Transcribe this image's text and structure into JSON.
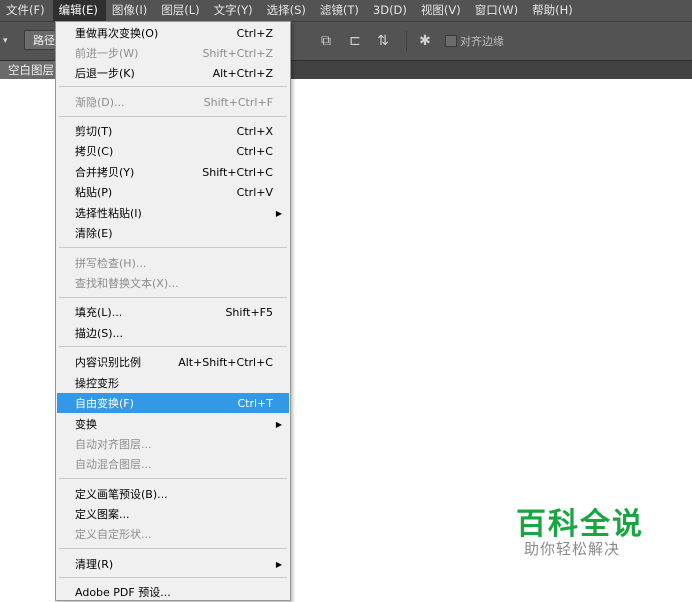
{
  "menubar": {
    "items": [
      {
        "label": "文件(F)"
      },
      {
        "label": "编辑(E)"
      },
      {
        "label": "图像(I)"
      },
      {
        "label": "图层(L)"
      },
      {
        "label": "文字(Y)"
      },
      {
        "label": "选择(S)"
      },
      {
        "label": "滤镜(T)"
      },
      {
        "label": "3D(D)"
      },
      {
        "label": "视图(V)"
      },
      {
        "label": "窗口(W)"
      },
      {
        "label": "帮助(H)"
      }
    ],
    "active_index": 1
  },
  "options_bar": {
    "path_button_label": "路径",
    "align_edges_label": "对齐边缘"
  },
  "document_tab": {
    "title": "空白图层"
  },
  "edit_menu": {
    "items": [
      {
        "label": "重做再次变换(O)",
        "shortcut": "Ctrl+Z",
        "disabled": false
      },
      {
        "label": "前进一步(W)",
        "shortcut": "Shift+Ctrl+Z",
        "disabled": true
      },
      {
        "label": "后退一步(K)",
        "shortcut": "Alt+Ctrl+Z",
        "disabled": false
      },
      {
        "label": "渐隐(D)...",
        "shortcut": "Shift+Ctrl+F",
        "disabled": true
      },
      {
        "label": "剪切(T)",
        "shortcut": "Ctrl+X",
        "disabled": false
      },
      {
        "label": "拷贝(C)",
        "shortcut": "Ctrl+C",
        "disabled": false
      },
      {
        "label": "合并拷贝(Y)",
        "shortcut": "Shift+Ctrl+C",
        "disabled": false
      },
      {
        "label": "粘贴(P)",
        "shortcut": "Ctrl+V",
        "disabled": false
      },
      {
        "label": "选择性粘贴(I)",
        "shortcut": "",
        "disabled": false,
        "submenu": true
      },
      {
        "label": "清除(E)",
        "shortcut": "",
        "disabled": false
      },
      {
        "label": "拼写检查(H)...",
        "shortcut": "",
        "disabled": true
      },
      {
        "label": "查找和替换文本(X)...",
        "shortcut": "",
        "disabled": true
      },
      {
        "label": "填充(L)...",
        "shortcut": "Shift+F5",
        "disabled": false
      },
      {
        "label": "描边(S)...",
        "shortcut": "",
        "disabled": false
      },
      {
        "label": "内容识别比例",
        "shortcut": "Alt+Shift+Ctrl+C",
        "disabled": false
      },
      {
        "label": "操控变形",
        "shortcut": "",
        "disabled": false
      },
      {
        "label": "自由变换(F)",
        "shortcut": "Ctrl+T",
        "disabled": false,
        "selected": true
      },
      {
        "label": "变换",
        "shortcut": "",
        "disabled": false,
        "submenu": true
      },
      {
        "label": "自动对齐图层...",
        "shortcut": "",
        "disabled": true
      },
      {
        "label": "自动混合图层...",
        "shortcut": "",
        "disabled": true
      },
      {
        "label": "定义画笔预设(B)...",
        "shortcut": "",
        "disabled": false
      },
      {
        "label": "定义图案...",
        "shortcut": "",
        "disabled": false
      },
      {
        "label": "定义自定形状...",
        "shortcut": "",
        "disabled": true
      },
      {
        "label": "清理(R)",
        "shortcut": "",
        "disabled": false,
        "submenu": true
      },
      {
        "label": "Adobe PDF 预设...",
        "shortcut": "",
        "disabled": false
      }
    ]
  },
  "watermark": {
    "title": "百科全说",
    "subtitle": "助你轻松解决"
  },
  "colors": {
    "chrome": "#535353",
    "menu_bg": "#f0f0f0",
    "highlight": "#3399e6",
    "watermark_green": "#19a642"
  },
  "icons": [
    "dropdown-arrow-icon",
    "arrange-icon",
    "align-icon",
    "path-arrangement-icon",
    "gear-icon",
    "submenu-arrow-icon"
  ]
}
